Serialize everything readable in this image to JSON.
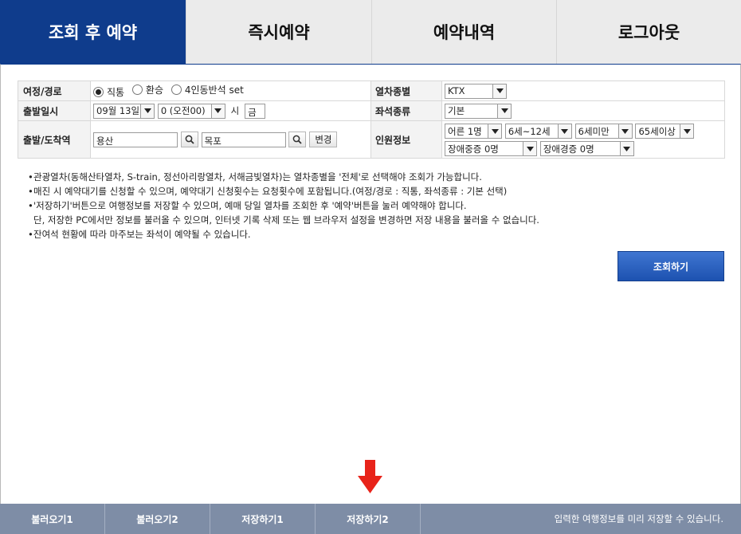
{
  "tabs": [
    {
      "label": "조회 후 예약",
      "active": true
    },
    {
      "label": "즉시예약",
      "active": false
    },
    {
      "label": "예약내역",
      "active": false
    },
    {
      "label": "로그아웃",
      "active": false
    }
  ],
  "form": {
    "route": {
      "label": "여정/경로",
      "options": [
        {
          "label": "직통",
          "checked": true
        },
        {
          "label": "환승",
          "checked": false
        },
        {
          "label": "4인동반석 set",
          "checked": false
        }
      ]
    },
    "train_type": {
      "label": "열차종별",
      "value": "KTX"
    },
    "departure_date": {
      "label": "출발일시",
      "date_value": "09월 13일",
      "hour_value": "0 (오전00)",
      "hour_suffix": "시",
      "weekday": "금"
    },
    "seat_type": {
      "label": "좌석종류",
      "value": "기본"
    },
    "stations": {
      "label": "출발/도착역",
      "departure": "용산",
      "arrival": "목포",
      "swap_label": "변경"
    },
    "passengers": {
      "label": "인원정보",
      "adult": "어른 1명",
      "child": "6세~12세",
      "infant": "6세미만",
      "senior": "65세이상",
      "disabled_severe": "장애중증 0명",
      "disabled_mild": "장애경증 0명"
    }
  },
  "notes": [
    "관광열차(동해산타열차, S-train, 정선아리랑열차, 서해금빛열차)는 열차종별을 '전체'로 선택해야 조회가 가능합니다.",
    "매진 시 예약대기를 신청할 수 있으며, 예약대기 신청횟수는 요청횟수에 포함됩니다.(여정/경로 : 직통, 좌석종류 : 기본 선택)",
    "'저장하기'버튼으로 여행정보를 저장할 수 있으며, 예매 당일 열차를 조회한 후 '예약'버튼을 눌러 예약해야 합니다.",
    "단, 저장한 PC에서만 정보를 불러올 수 있으며, 인터넷 기록 삭제 또는 웹 브라우저 설정을 변경하면 저장 내용을 불러올 수 없습니다.",
    "잔여석 현황에 따라 마주보는 좌석이 예약될 수 있습니다."
  ],
  "search_button": "조회하기",
  "bottom_bar": {
    "buttons": [
      "불러오기1",
      "불러오기2",
      "저장하기1",
      "저장하기2"
    ],
    "message": "입력한 여행정보를 미리 저장할 수 있습니다."
  },
  "colors": {
    "active_tab": "#0f3c8c",
    "bottom_bar": "#7e8da6",
    "arrow": "#e8231a",
    "search_button": "#2a60be"
  },
  "icons": [
    "magnifier-icon",
    "dropdown-arrow-icon",
    "down-arrow-icon"
  ]
}
